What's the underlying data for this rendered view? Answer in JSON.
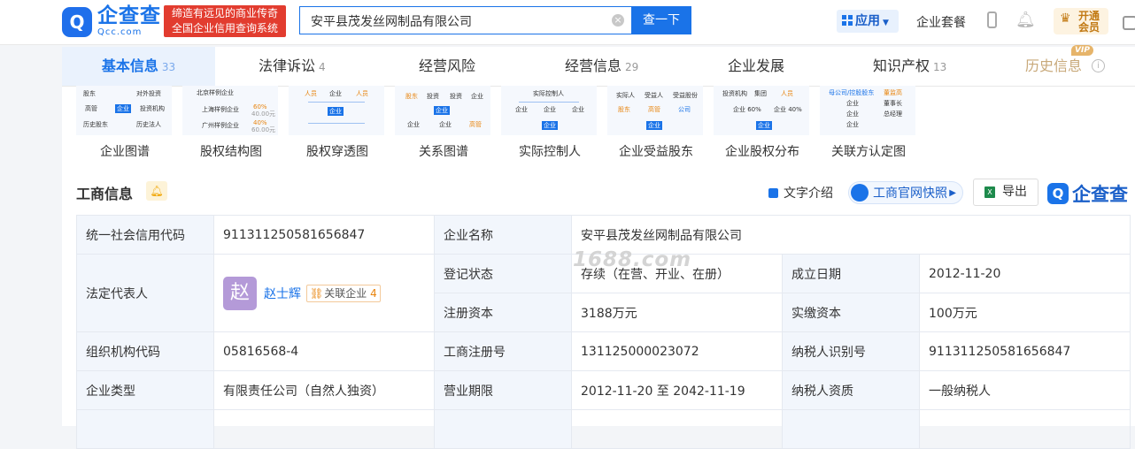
{
  "header": {
    "logo_text": "企查查",
    "logo_sub": "Qcc.com",
    "slogan_line1": "缔造有远见的商业传奇",
    "slogan_line2": "全国企业信用查询系统",
    "search_value": "安平县茂发丝网制品有限公司",
    "search_button": "查一下",
    "app_button": "应用",
    "suite_link": "企业套餐",
    "vip_line1": "开通",
    "vip_line2": "会员"
  },
  "tabs": [
    {
      "label": "基本信息",
      "count": "33"
    },
    {
      "label": "法律诉讼",
      "count": "4"
    },
    {
      "label": "经营风险",
      "count": ""
    },
    {
      "label": "经营信息",
      "count": "29"
    },
    {
      "label": "企业发展",
      "count": ""
    },
    {
      "label": "知识产权",
      "count": "13"
    },
    {
      "label": "历史信息",
      "count": ""
    }
  ],
  "vip_tag": "VIP",
  "tools": [
    {
      "label": "企业图谱",
      "t": [
        "股东",
        "对外投资",
        "高管",
        "企业",
        "投资机构",
        "历史股东",
        "历史法人"
      ]
    },
    {
      "label": "股权结构图",
      "t": [
        "北京样例企业",
        "上海样例企业",
        "60%",
        "40.00元",
        "广州样例企业",
        "40%",
        "60.00元"
      ]
    },
    {
      "label": "股权穿透图",
      "t": [
        "人员",
        "企业",
        "人员",
        "企业"
      ]
    },
    {
      "label": "关系图谱",
      "t": [
        "股东",
        "投资",
        "投资",
        "企业",
        "企业",
        "企业",
        "企业",
        "高管"
      ]
    },
    {
      "label": "实际控制人",
      "t": [
        "实际控制人",
        "企业",
        "企业",
        "企业",
        "企业"
      ]
    },
    {
      "label": "企业受益股东",
      "t": [
        "实际人",
        "受益人",
        "受益股份",
        "股东",
        "高管",
        "公司",
        "企业"
      ]
    },
    {
      "label": "企业股权分布",
      "t": [
        "投资机构",
        "集团",
        "人员",
        "企业 60%",
        "企业 40%",
        "企业"
      ]
    },
    {
      "label": "关联方认定图",
      "t": [
        "母公司/控股股东",
        "董监高",
        "企业",
        "企业",
        "董事长",
        "企业",
        "总经理"
      ]
    }
  ],
  "section": {
    "title": "工商信息",
    "text_intro": "文字介绍",
    "snapshot": "工商官网快照",
    "export": "导出",
    "brand": "企查查"
  },
  "watermark": "1688.com",
  "biz": {
    "credit_code_label": "统一社会信用代码",
    "credit_code": "911311250581656847",
    "company_name_label": "企业名称",
    "company_name": "安平县茂发丝网制品有限公司",
    "legal_rep_label": "法定代表人",
    "avatar_char": "赵",
    "legal_rep_name": "赵士辉",
    "related_label": "关联企业",
    "related_count": "4",
    "status_label": "登记状态",
    "status": "存续（在营、开业、在册）",
    "founded_label": "成立日期",
    "founded": "2012-11-20",
    "reg_capital_label": "注册资本",
    "reg_capital": "3188万元",
    "paid_capital_label": "实缴资本",
    "paid_capital": "100万元",
    "org_code_label": "组织机构代码",
    "org_code": "05816568-4",
    "reg_no_label": "工商注册号",
    "reg_no": "131125000023072",
    "taxpayer_id_label": "纳税人识别号",
    "taxpayer_id": "911311250581656847",
    "type_label": "企业类型",
    "type": "有限责任公司（自然人独资）",
    "term_label": "营业期限",
    "term": "2012-11-20 至 2042-11-19",
    "tax_qual_label": "纳税人资质",
    "tax_qual": "一般纳税人"
  }
}
